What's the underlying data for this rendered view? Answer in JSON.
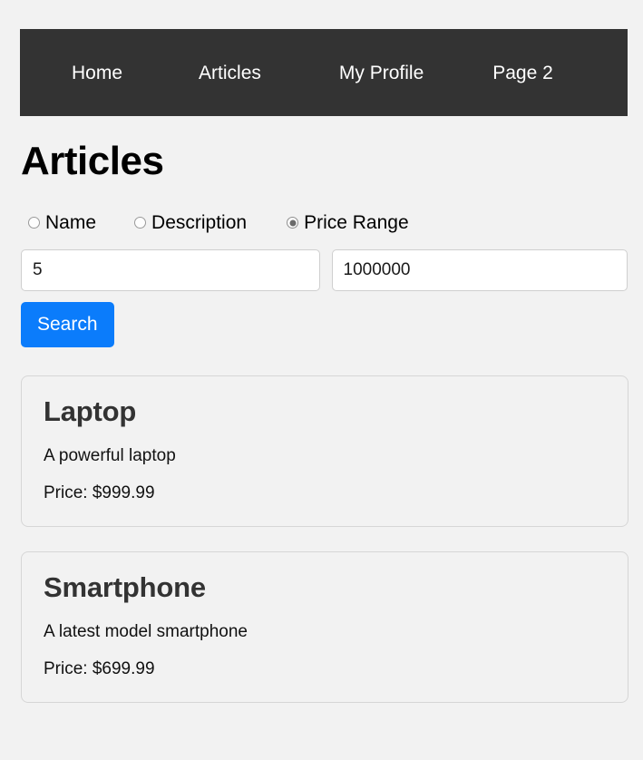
{
  "navbar": {
    "links": [
      {
        "label": "Home"
      },
      {
        "label": "Articles"
      },
      {
        "label": "My Profile"
      },
      {
        "label": "Page 2"
      }
    ],
    "background_color": "#333333",
    "text_color": "#ffffff"
  },
  "page": {
    "title": "Articles",
    "background_color": "#f2f2f2"
  },
  "search": {
    "radios": [
      {
        "label": "Name",
        "checked": false
      },
      {
        "label": "Description",
        "checked": false
      },
      {
        "label": "Price Range",
        "checked": true
      }
    ],
    "min_price_value": "5",
    "min_price_placeholder": "Min price",
    "max_price_value": "1000000",
    "max_price_placeholder": "Max price",
    "button_label": "Search",
    "button_color": "#0b7cfb"
  },
  "articles": [
    {
      "title": "Laptop",
      "description": "A powerful laptop",
      "price": "Price: $999.99"
    },
    {
      "title": "Smartphone",
      "description": "A latest model smartphone",
      "price": "Price: $699.99"
    }
  ]
}
